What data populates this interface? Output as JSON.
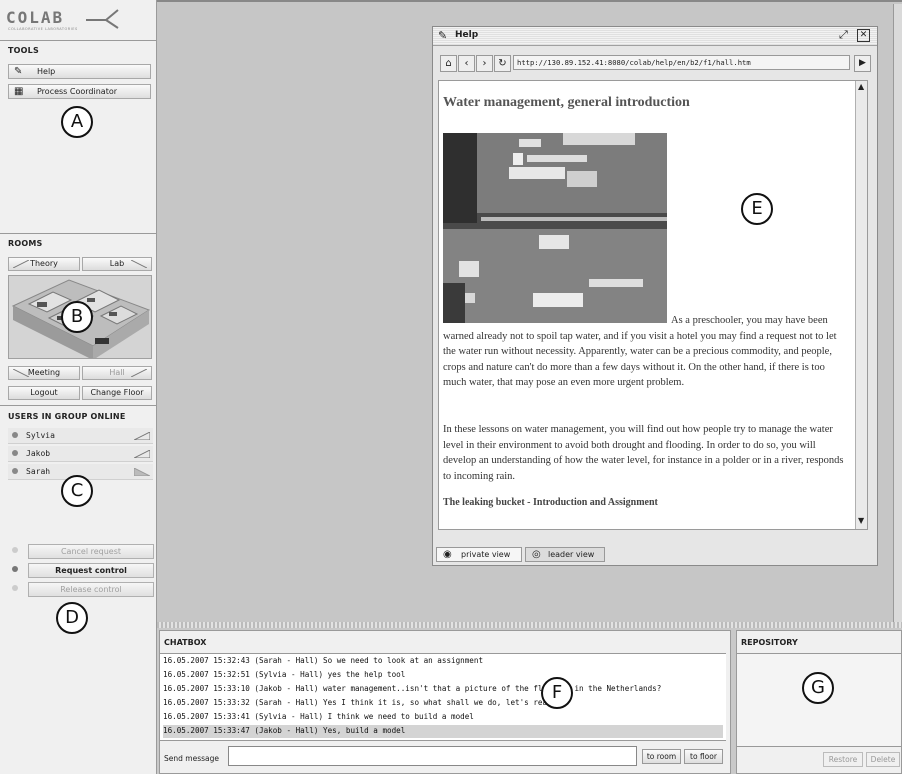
{
  "logo": {
    "text": "COLAB",
    "subtitle": "COLLABORATIVE LABORATORIES"
  },
  "tools": {
    "title": "TOOLS",
    "items": [
      {
        "label": "Help",
        "icon": "help-icon"
      },
      {
        "label": "Process Coordinator",
        "icon": "process-coordinator-icon"
      }
    ]
  },
  "rooms": {
    "title": "ROOMS",
    "top_buttons": [
      "Theory",
      "Lab"
    ],
    "bottom_buttons": [
      "Meeting",
      "Hall"
    ],
    "logout": "Logout",
    "change_floor": "Change Floor"
  },
  "users": {
    "title": "USERS IN GROUP ONLINE",
    "list": [
      "Sylvia",
      "Jakob",
      "Sarah"
    ]
  },
  "control": {
    "cancel": "Cancel request",
    "request": "Request control",
    "release": "Release control"
  },
  "markers": {
    "a": "A",
    "b": "B",
    "c": "C",
    "d": "D",
    "e": "E",
    "f": "F",
    "g": "G"
  },
  "help_window": {
    "title": "Help",
    "url": "http://130.89.152.41:8080/colab/help/en/b2/f1/hall.htm",
    "heading": "Water management, general introduction",
    "para1": "As a preschooler, you may have been warned already not to spoil tap water, and if you visit a hotel you may find a request not to let the water run without necessity. Apparently, water can be a precious commodity, and people, crops and nature can't do more than a few days without it. On the other hand, if there is too much water, that may pose an even more urgent problem.",
    "para2": "In these lessons on water management, you will find out how people try to manage the water level in their environment to avoid both drought and flooding. In order to do so, you will develop an understanding of how the water level, for instance in a polder or in a river, responds to incoming rain.",
    "subheading": "The leaking bucket - Introduction and Assignment",
    "tabs": [
      "private view",
      "leader view"
    ]
  },
  "chatbox": {
    "title": "CHATBOX",
    "messages": [
      "16.05.2007 15:32:43 (Sarah - Hall) So we need to look at an assignment",
      "16.05.2007 15:32:51 (Sylvia - Hall) yes the help tool",
      "16.05.2007 15:33:10 (Jakob - Hall) water management..isn't that a picture of the flooding in the Netherlands?",
      "16.05.2007 15:33:32 (Sarah - Hall) Yes I think it is, so what shall we do, let's read",
      "16.05.2007 15:33:41 (Sylvia - Hall) I think we need to build a model",
      "16.05.2007 15:33:47 (Jakob - Hall) Yes, build a model"
    ],
    "send_label": "Send message",
    "input_value": "",
    "to_room": "to room",
    "to_floor": "to floor"
  },
  "repository": {
    "title": "REPOSITORY",
    "restore": "Restore",
    "delete": "Delete"
  }
}
